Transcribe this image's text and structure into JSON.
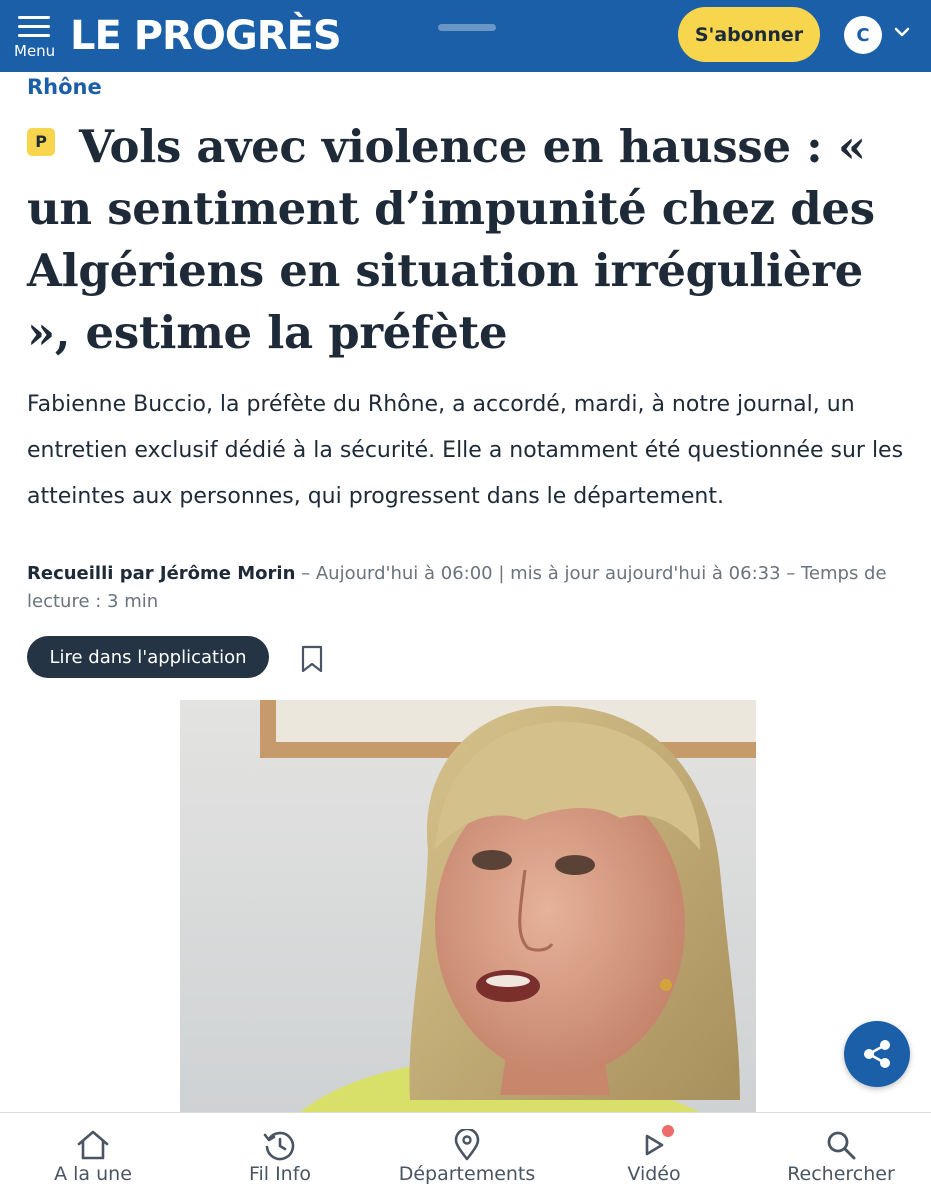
{
  "header": {
    "menu_label": "Menu",
    "logo_text": "LE PROGRÈS",
    "subscribe_label": "S'abonner",
    "avatar_initial": "C",
    "background_color": "#1b5fa8",
    "subscribe_color": "#f7d54c"
  },
  "article": {
    "section": "Rhône",
    "premium_badge": "P",
    "title": "Vols avec violence en hausse : « un sentiment d’impunité chez des Algériens en situation irrégulière », estime la préfète",
    "lead": "Fabienne Buccio, la préfète du Rhône, a accordé, mardi, à notre journal, un entretien exclusif dédié à la sécurité. Elle a notamment été questionnée sur les atteintes aux personnes, qui progressent dans le département.",
    "author": "Recueilli par Jérôme Morin",
    "meta": " – Aujourd'hui à 06:00 | mis à jour aujourd'hui à 06:33 – Temps de lecture : 3 min",
    "app_button_label": "Lire dans l'application",
    "bookmark_icon": "bookmark-icon",
    "share_icon": "share-icon"
  },
  "bottom_nav": {
    "items": [
      {
        "label": "A la une",
        "icon": "home-icon"
      },
      {
        "label": "Fil Info",
        "icon": "history-icon"
      },
      {
        "label": "Départements",
        "icon": "location-pin-icon"
      },
      {
        "label": "Vidéo",
        "icon": "play-icon"
      },
      {
        "label": "Rechercher",
        "icon": "search-icon"
      }
    ]
  }
}
